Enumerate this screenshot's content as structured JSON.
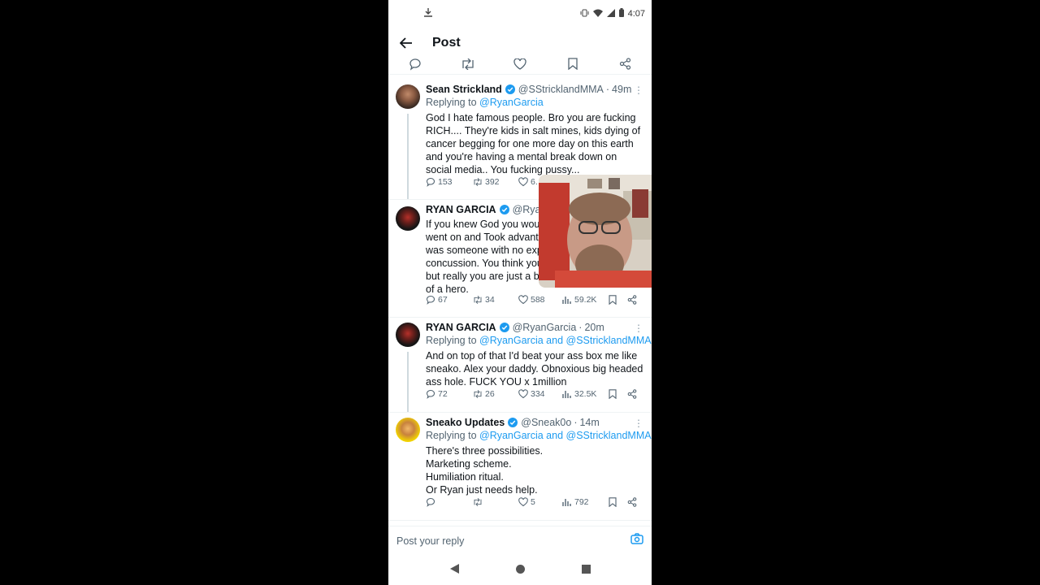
{
  "status_bar": {
    "time": "4:07"
  },
  "header": {
    "title": "Post"
  },
  "tweets": [
    {
      "name": "Sean Strickland",
      "handle": "@SStricklandMMA",
      "dot": "·",
      "time": "49m",
      "replying_prefix": "Replying to ",
      "replying_to": "@RyanGarcia",
      "text": "God I hate famous people. Bro you are fucking RICH.... They're kids in salt mines, kids dying of cancer begging for one more day on this earth and you're having a mental break down on social media..  You fucking pussy...",
      "replies": "153",
      "reposts": "392",
      "likes": "6.…"
    },
    {
      "name": "RYAN GARCIA",
      "handle": "@Ryan",
      "text": "If you knew God you wou\nwent on and Took advant\nwas someone with no exp\nconcussion. You think you\nbut really you are just a bu\nof a hero.",
      "replies": "67",
      "reposts": "34",
      "likes": "588",
      "views": "59.2K"
    },
    {
      "name": "RYAN GARCIA",
      "handle": "@RyanGarcia",
      "dot": "·",
      "time": "20m",
      "replying_prefix": "Replying to ",
      "replying_to": "@RyanGarcia and @SStricklandMMA",
      "text": "And on top of that I'd beat your ass box me like sneako. Alex your daddy. Obnoxious big headed ass hole. FUCK YOU x 1million",
      "replies": "72",
      "reposts": "26",
      "likes": "334",
      "views": "32.5K"
    },
    {
      "name": "Sneako Updates",
      "handle": "@Sneak0o",
      "dot": "·",
      "time": "14m",
      "replying_prefix": "Replying to ",
      "replying_to": "@RyanGarcia and @SStricklandMMA",
      "text": "There's three possibilities.\nMarketing scheme.\nHumiliation ritual.\nOr Ryan just needs help.",
      "likes": "5",
      "views": "792"
    }
  ],
  "reply_bar": {
    "placeholder": "Post your reply"
  },
  "colors": {
    "accent": "#1d9bf0",
    "text": "#0f1419",
    "muted": "#536471"
  },
  "icons": [
    "download-icon",
    "vibrate-icon",
    "wifi-icon",
    "signal-icon",
    "battery-icon",
    "back-arrow-icon",
    "reply-icon",
    "repost-icon",
    "like-icon",
    "bookmark-icon",
    "share-icon",
    "verified-icon",
    "more-icon",
    "views-icon",
    "camera-icon"
  ]
}
